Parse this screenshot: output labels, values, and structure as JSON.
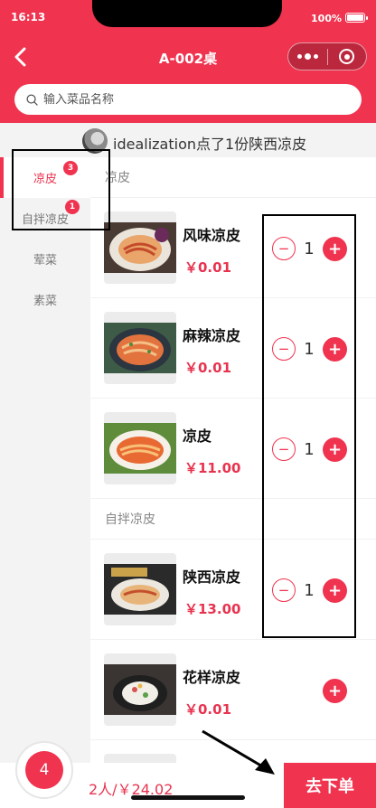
{
  "status": {
    "time": "16:13",
    "battery": "100%"
  },
  "nav": {
    "title": "A-002桌"
  },
  "search": {
    "placeholder": "输入菜品名称"
  },
  "notice": {
    "message": "idealization点了1份陕西凉皮"
  },
  "sidebar": {
    "items": [
      {
        "label": "凉皮",
        "badge": "3",
        "active": true
      },
      {
        "label": "自拌凉皮",
        "badge": "1",
        "active": false
      },
      {
        "label": "荤菜",
        "badge": "",
        "active": false
      },
      {
        "label": "素菜",
        "badge": "",
        "active": false
      }
    ]
  },
  "sections": [
    {
      "title": "凉皮",
      "items": [
        {
          "name": "风味凉皮",
          "price": "￥0.01",
          "qty": "1"
        },
        {
          "name": "麻辣凉皮",
          "price": "￥0.01",
          "qty": "1"
        },
        {
          "name": "凉皮",
          "price": "￥11.00",
          "qty": "1"
        }
      ]
    },
    {
      "title": "自拌凉皮",
      "items": [
        {
          "name": "陕西凉皮",
          "price": "￥13.00",
          "qty": "1"
        },
        {
          "name": "花样凉皮",
          "price": "￥0.01",
          "qty": ""
        }
      ]
    }
  ],
  "cart": {
    "count": "4",
    "summary": "2人/￥24.02",
    "checkout_label": "去下单"
  },
  "icons": {
    "minus": "−",
    "plus": "+",
    "back": "chevron-left-icon"
  },
  "colors": {
    "brand": "#f0334f",
    "price": "#e8334f"
  }
}
